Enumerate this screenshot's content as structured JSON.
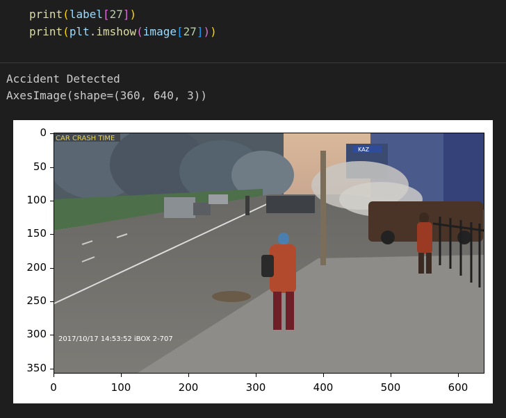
{
  "code": {
    "line1": {
      "fn": "print",
      "open": "(",
      "var": "label",
      "lb": "[",
      "idx": "27",
      "rb": "]",
      "close": ")"
    },
    "line2": {
      "fn": "print",
      "open": "(",
      "obj": "plt",
      "dot": ".",
      "method": "imshow",
      "open2": "(",
      "var": "image",
      "lb": "[",
      "idx": "27",
      "rb": "]",
      "close2": ")",
      "close": ")"
    }
  },
  "output": {
    "line1": "Accident Detected",
    "line2": "AxesImage(shape=(360, 640, 3))"
  },
  "plot": {
    "image_overlay": {
      "top_left_caption": "CAR CRASH TIME",
      "timestamp": "2017/10/17  14:53:52  iBOX 2-707",
      "sign_text": "KAZ"
    },
    "y_ticks": [
      "0",
      "50",
      "100",
      "150",
      "200",
      "250",
      "300",
      "350"
    ],
    "x_ticks": [
      "0",
      "100",
      "200",
      "300",
      "400",
      "500",
      "600"
    ]
  },
  "colors": {
    "background": "#1e1e1e",
    "fn": "#dcdcaa",
    "variable": "#9cdcfe",
    "number": "#b5cea8",
    "output_text": "#cccccc"
  }
}
